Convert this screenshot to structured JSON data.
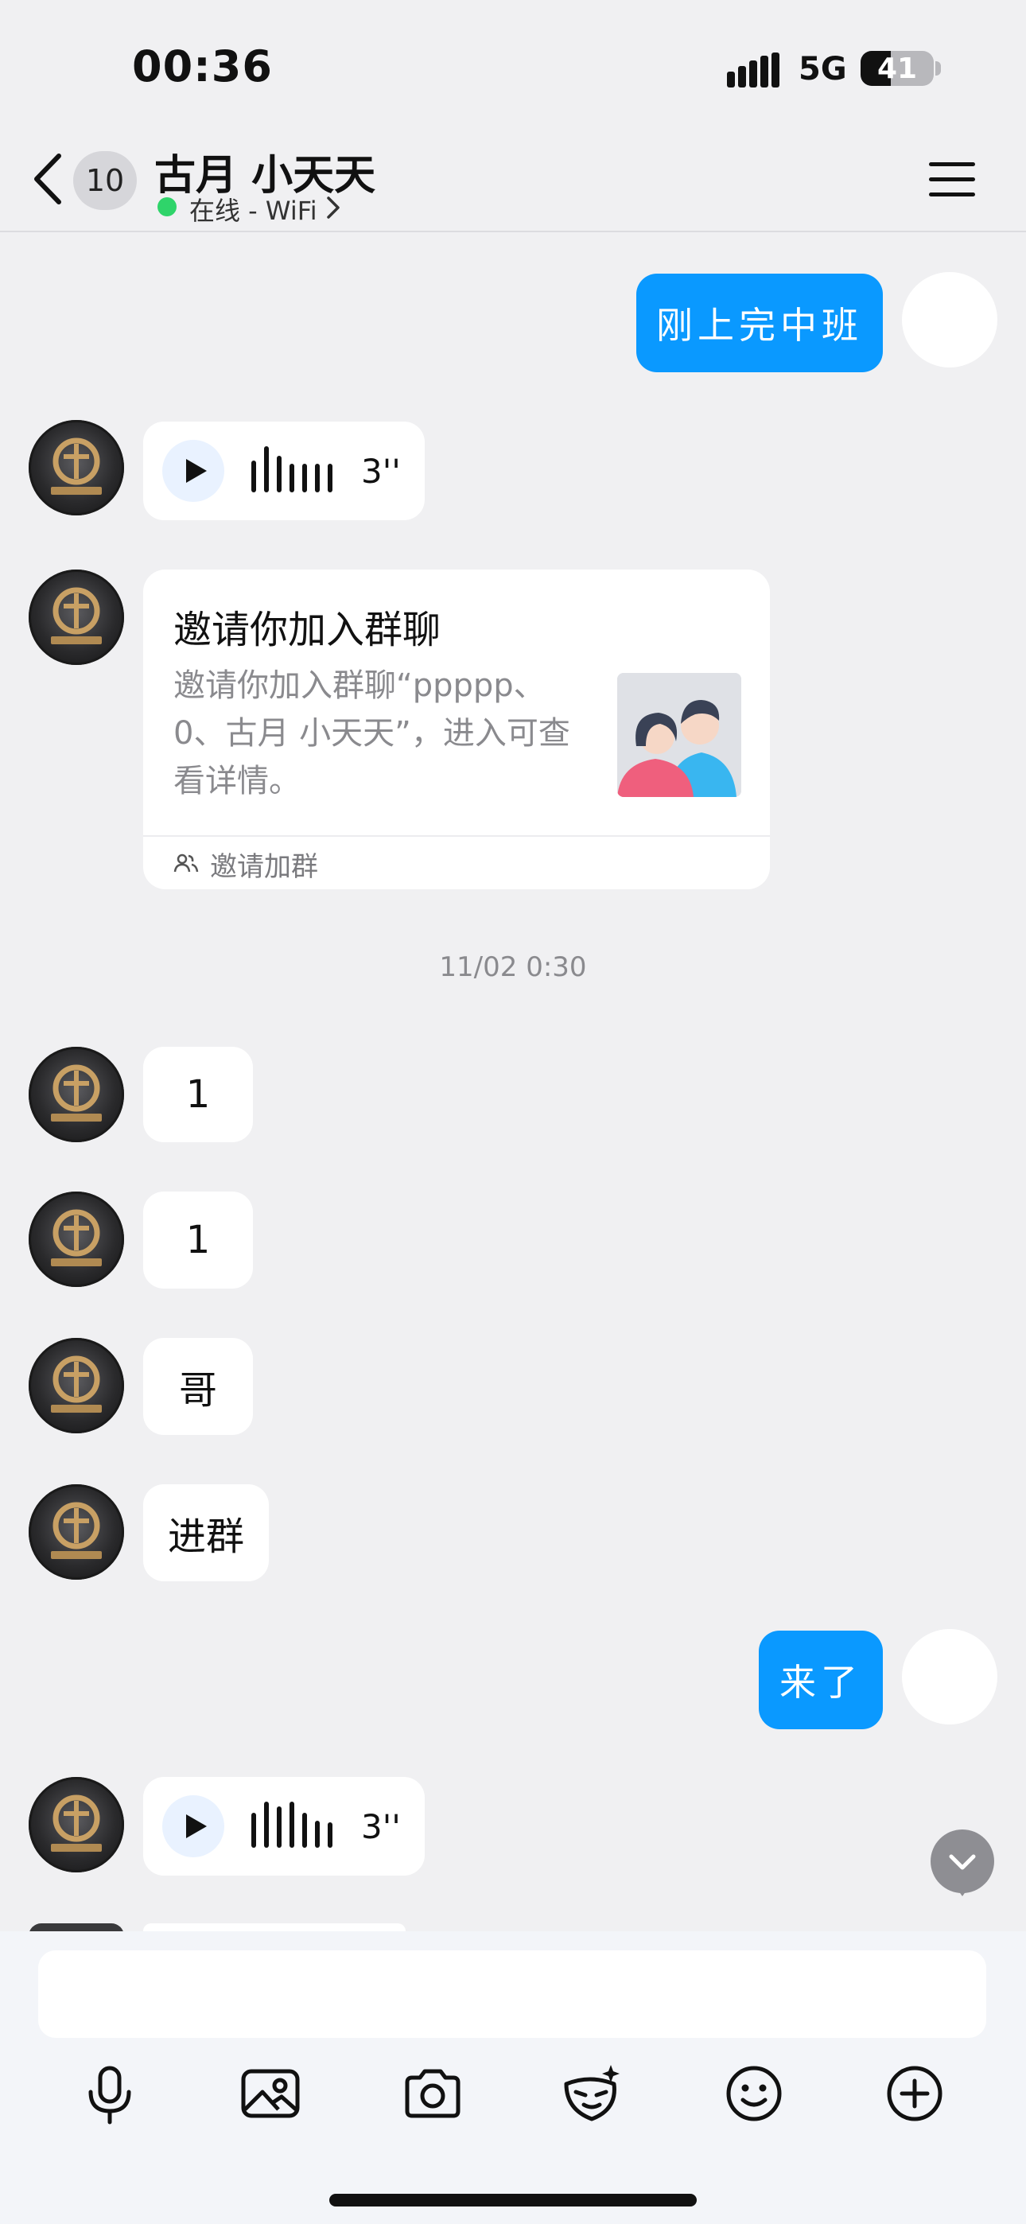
{
  "status_bar": {
    "time": "00:36",
    "network": "5G",
    "battery": "41",
    "battery_level": 0.41
  },
  "header": {
    "back_count": "10",
    "contact_name": "古月 小天天",
    "online_status": "在线 - WiFi"
  },
  "messages": {
    "m1_text": "刚上完中班",
    "m2_voice_duration": "3''",
    "invite": {
      "title": "邀请你加入群聊",
      "description": "邀请你加入群聊“ppppp、0、古月 小天天”，进入可查看详情。",
      "footer": "邀请加群"
    },
    "timestamp": "11/02 0:30",
    "m3_text": "1",
    "m4_text": "1",
    "m5_text": "哥",
    "m6_text": "进群",
    "m7_text": "来了",
    "m8_voice_duration": "3''"
  },
  "toolbar": {
    "icons": [
      "microphone-icon",
      "image-icon",
      "camera-icon",
      "sticker-icon",
      "emoji-icon",
      "plus-icon"
    ]
  },
  "colors": {
    "accent": "#0a99ff",
    "online": "#2fd46a",
    "background": "#f0f0f2"
  }
}
